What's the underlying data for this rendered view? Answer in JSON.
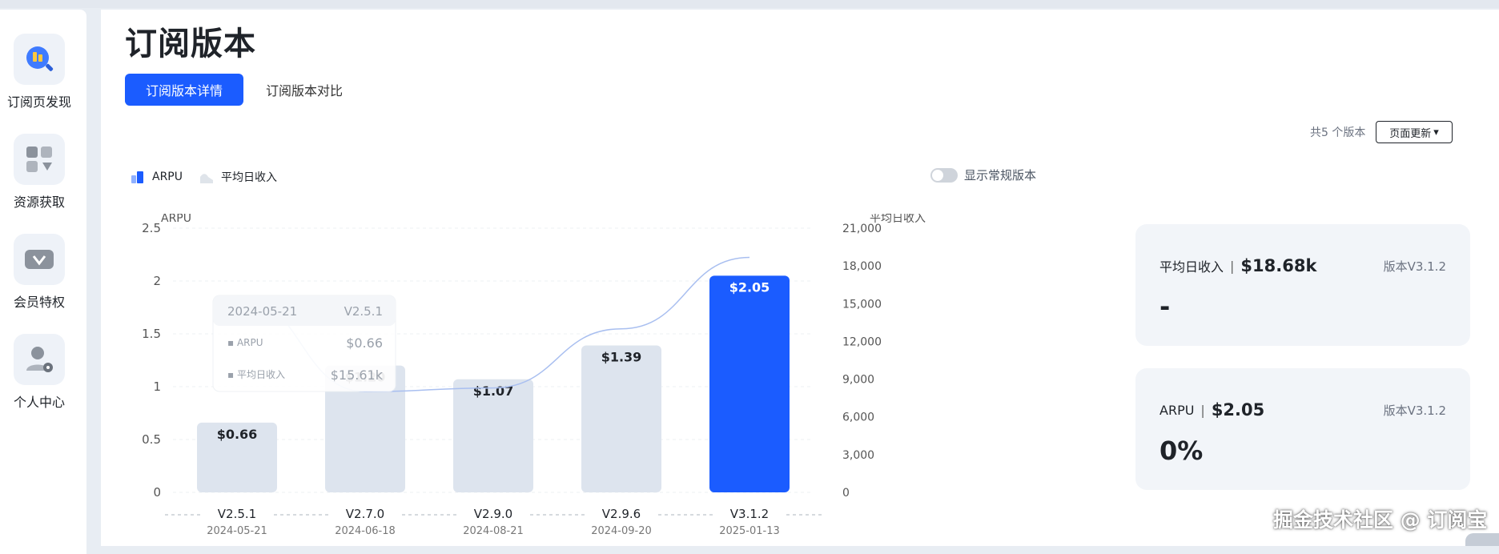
{
  "sidebar": {
    "items": [
      {
        "label": "订阅页发现",
        "icon": "subscription-discovery-icon"
      },
      {
        "label": "资源获取",
        "icon": "resource-acquire-icon"
      },
      {
        "label": "会员特权",
        "icon": "vip-privilege-icon"
      },
      {
        "label": "个人中心",
        "icon": "user-settings-icon"
      }
    ]
  },
  "page": {
    "title": "订阅版本"
  },
  "tabs": [
    {
      "label": "订阅版本详情",
      "active": true
    },
    {
      "label": "订阅版本对比",
      "active": false
    }
  ],
  "toolbar": {
    "version_count": "共5 个版本",
    "page_update_label": "页面更新",
    "caret": "▾"
  },
  "legend": {
    "arpu_label": "ARPU",
    "avg_label": "平均日收入"
  },
  "toggle": {
    "label": "显示常规版本",
    "on": false
  },
  "tooltip": {
    "date": "2024-05-21",
    "version": "V2.5.1",
    "arpu_label": "ARPU",
    "arpu_value": "$0.66",
    "avg_label": "平均日收入",
    "avg_value": "$15.61k"
  },
  "cards": [
    {
      "label": "平均日收入",
      "sep": "|",
      "value": "$18.68k",
      "version": "版本V3.1.2",
      "big": "-"
    },
    {
      "label": "ARPU",
      "sep": "|",
      "value": "$2.05",
      "version": "版本V3.1.2",
      "big": "0%"
    }
  ],
  "colors": {
    "accent": "#1b5cff",
    "bar": "#dde4ee",
    "bar_active": "#1b5cff",
    "line": "#a9bff0"
  },
  "watermark": "掘金技术社区 @ 订阅宝",
  "chart_data": {
    "type": "bar",
    "categories": [
      "V2.5.1",
      "V2.7.0",
      "V2.9.0",
      "V2.9.6",
      "V3.1.2"
    ],
    "dates": [
      "2024-05-21",
      "2024-06-18",
      "2024-08-21",
      "2024-09-20",
      "2025-01-13"
    ],
    "series": [
      {
        "name": "ARPU",
        "type": "bar",
        "axis": "left",
        "values": [
          0.66,
          1.2,
          1.07,
          1.39,
          2.05
        ],
        "labels": [
          "$0.66",
          "$1.20",
          "$1.07",
          "$1.39",
          "$2.05"
        ]
      },
      {
        "name": "平均日收入",
        "type": "line",
        "axis": "right",
        "values": [
          15610,
          8000,
          8300,
          13000,
          18680
        ]
      }
    ],
    "highlight_index": 4,
    "ylabel": "ARPU",
    "ylabel_right": "平均日收入",
    "ylim": [
      0,
      2.5
    ],
    "ylim_right": [
      0,
      21000
    ],
    "yticks": [
      0,
      0.5,
      1,
      1.5,
      2,
      2.5
    ],
    "yticks_labels": [
      "0",
      "0.5",
      "1",
      "1.5",
      "2",
      "2.5"
    ],
    "yticks_right": [
      0,
      3000,
      6000,
      9000,
      12000,
      15000,
      18000,
      21000
    ],
    "yticks_right_labels": [
      "0",
      "3,000",
      "6,000",
      "9,000",
      "12,000",
      "15,000",
      "18,000",
      "21,000"
    ],
    "grid": true
  }
}
